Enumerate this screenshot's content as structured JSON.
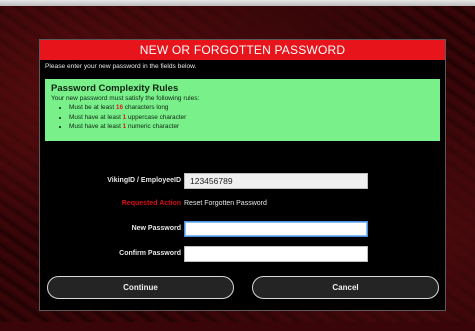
{
  "dialog": {
    "title": "NEW OR FORGOTTEN PASSWORD",
    "instructions": "Please enter your new password in the fields below."
  },
  "rules": {
    "heading": "Password Complexity Rules",
    "intro": "Your new password must satisfy the following rules:",
    "items": [
      {
        "prefix": "Must be at least ",
        "num": "16",
        "suffix": " characters long"
      },
      {
        "prefix": "Must have at least ",
        "num": "1",
        "suffix": " uppercase character"
      },
      {
        "prefix": "Must have at least ",
        "num": "1",
        "suffix": " numeric character"
      }
    ]
  },
  "form": {
    "viking_id_label": "VikingID / EmployeeID",
    "viking_id_value": "123456789",
    "requested_action_label": "Requested Action",
    "requested_action_value": "Reset Forgotten Password",
    "new_password_label": "New Password",
    "new_password_value": "",
    "confirm_password_label": "Confirm Password",
    "confirm_password_value": ""
  },
  "buttons": {
    "continue_label": "Continue",
    "cancel_label": "Cancel"
  },
  "colors": {
    "accent_red": "#e8141b",
    "rules_green": "#79f08a"
  }
}
